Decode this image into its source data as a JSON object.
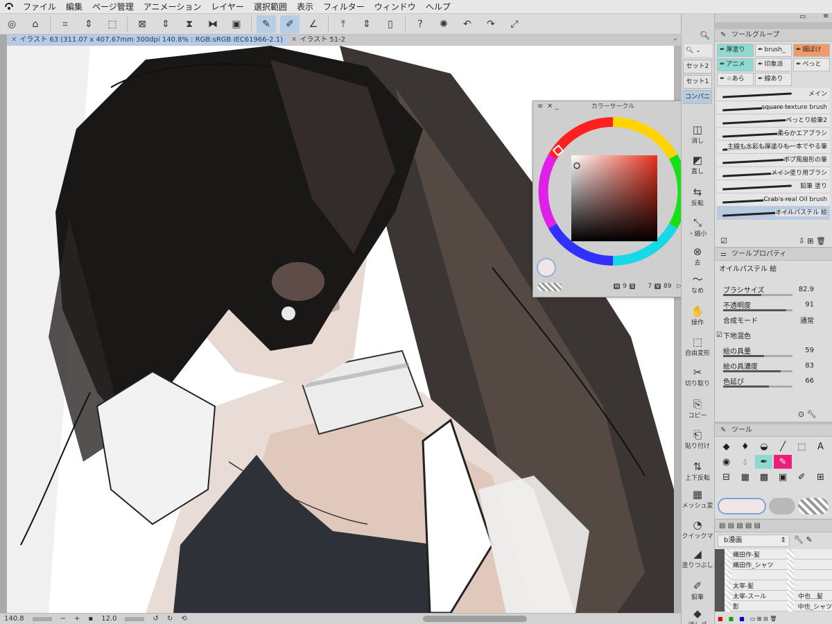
{
  "menubar": {
    "items": [
      "ファイル",
      "編集",
      "ページ管理",
      "アニメーション",
      "レイヤー",
      "選択範囲",
      "表示",
      "フィルター",
      "ウィンドウ",
      "ヘルプ"
    ]
  },
  "tabs": [
    {
      "label": "イラスト 63 (311.07 x 407.67mm 300dpi 140.8% : RGB:sRGB IEC61966-2.1)"
    },
    {
      "label": "イラスト 51-2"
    }
  ],
  "canvas": {
    "background": "#ffffff"
  },
  "statusbar": {
    "zoom": "140.8",
    "minus": "−",
    "plus": "+",
    "angle": "12.0"
  },
  "color_circle": {
    "title": "カラーサークル",
    "h_label": "H",
    "h": "9",
    "s_label": "S",
    "s": "7",
    "v_label": "V",
    "v": "89"
  },
  "sets": {
    "set2": "セット2",
    "set1": "セット1",
    "companion": "コンパニ"
  },
  "commands": [
    {
      "label": "消し",
      "icon": "eraser-icon"
    },
    {
      "label": "直し",
      "icon": "undo-icon"
    },
    {
      "label": "反転",
      "icon": "flip-icon"
    },
    {
      "label": "・縮小",
      "icon": "shrink-icon"
    },
    {
      "label": "去",
      "icon": "remove-icon"
    },
    {
      "label": "なめ",
      "icon": "smooth-icon"
    },
    {
      "label": "操作",
      "icon": "hand-icon"
    },
    {
      "label": "自由変形",
      "icon": "transform-icon"
    },
    {
      "label": "切り取り",
      "icon": "scissors-icon"
    },
    {
      "label": "コピー",
      "icon": "copy-icon"
    },
    {
      "label": "貼り付け",
      "icon": "paste-icon"
    },
    {
      "label": "上下反転",
      "icon": "vflip-icon"
    },
    {
      "label": "メッシュ変",
      "icon": "mesh-icon"
    },
    {
      "label": "クイックマ",
      "icon": "quickmask-icon"
    },
    {
      "label": "塗りつぶし",
      "icon": "bucket-icon"
    },
    {
      "label": "鉛筆",
      "icon": "pencil-icon"
    },
    {
      "label": "消しゴ",
      "icon": "eraser2-icon"
    }
  ],
  "tool_group": {
    "title": "ツールグループ",
    "items": [
      "厚塗り",
      "brush_",
      "細ぼけ",
      "アニメ",
      "印象派",
      "べっと",
      "☆あら",
      "線あり"
    ]
  },
  "brushes": [
    {
      "name": "メイン"
    },
    {
      "name": "square texture brush"
    },
    {
      "name": "べっとり絵筆2"
    },
    {
      "name": "柔らかエアブラシ"
    },
    {
      "name": "主線も水彩も厚塗りも一本でやる筆"
    },
    {
      "name": "ポプ風扇形の筆"
    },
    {
      "name": "メイン塗り用ブラシ"
    },
    {
      "name": "鉛筆 塗り"
    },
    {
      "name": "Crab's real Oil brush"
    },
    {
      "name": "オイルパステル 絵"
    }
  ],
  "tool_property": {
    "title": "ツールプロパティ",
    "tool_name": "オイルパステル 絵",
    "rows": [
      {
        "label": "ブラシサイズ",
        "value": "82.9",
        "fill": 0.55
      },
      {
        "label": "不透明度",
        "value": "91",
        "fill": 0.91
      },
      {
        "label": "合成モード",
        "value": "通常",
        "fill": 0
      },
      {
        "label": "下地混色",
        "value": "",
        "fill": 0
      },
      {
        "label": "絵の具量",
        "value": "59",
        "fill": 0.59
      },
      {
        "label": "絵の具濃度",
        "value": "83",
        "fill": 0.83
      },
      {
        "label": "色延び",
        "value": "66",
        "fill": 0.66
      }
    ]
  },
  "tool_panel": {
    "title": "ツール"
  },
  "layers": {
    "set_name": "b漫画",
    "rows": [
      {
        "left": "織田作-髪",
        "right": ""
      },
      {
        "left": "織田作_シャツ",
        "right": ""
      },
      {
        "left": "",
        "right": ""
      },
      {
        "left": "太宰-髪",
        "right": ""
      },
      {
        "left": "太宰-スール",
        "right": "中也＿髪"
      },
      {
        "left": "影",
        "right": "中也_シャツ"
      }
    ]
  },
  "colors": {
    "accent": "#b7cbe3",
    "teal": "#8ed9d0",
    "pink": "#e8207a",
    "orange": "#f09a6a"
  }
}
